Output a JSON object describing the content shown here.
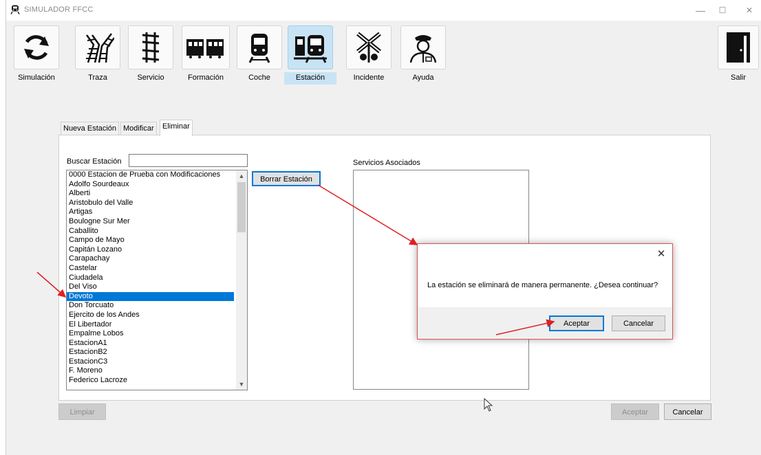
{
  "window": {
    "title": "SIMULADOR FFCC",
    "controls": {
      "minimize": "—",
      "maximize": "☐",
      "close": "✕"
    }
  },
  "toolbar": {
    "items": [
      {
        "label": "Simulación",
        "icon": "refresh-icon"
      },
      {
        "label": "Traza",
        "icon": "tracks-junction-icon"
      },
      {
        "label": "Servicio",
        "icon": "rail-track-icon"
      },
      {
        "label": "Formación",
        "icon": "train-formation-icon"
      },
      {
        "label": "Coche",
        "icon": "train-car-icon"
      },
      {
        "label": "Estación",
        "icon": "station-icon",
        "active": true
      },
      {
        "label": "Incidente",
        "icon": "railroad-crossing-icon"
      },
      {
        "label": "Ayuda",
        "icon": "conductor-icon"
      }
    ],
    "exit_label": "Salir"
  },
  "tabs": [
    "Nueva Estación",
    "Modificar",
    "Eliminar"
  ],
  "selected_tab": "Eliminar",
  "search": {
    "label": "Buscar Estación",
    "value": ""
  },
  "stations": [
    "0000 Estacion de Prueba con Modificaciones",
    "Adolfo Sourdeaux",
    "Alberti",
    "Aristobulo del Valle",
    "Artigas",
    "Boulogne Sur Mer",
    "Caballito",
    "Campo de Mayo",
    "Capitán Lozano",
    "Carapachay",
    "Castelar",
    "Ciudadela",
    "Del Viso",
    "Devoto",
    "Don Torcuato",
    "Ejercito de los Andes",
    "El Libertador",
    "Empalme Lobos",
    "EstacionA1",
    "EstacionB2",
    "EstacionC3",
    "F. Moreno",
    "Federico Lacroze"
  ],
  "selected_station": "Devoto",
  "delete_button": "Borrar Estación",
  "services_label": "Servicios Asociados",
  "bottom": {
    "clear": "Limpiar",
    "accept": "Aceptar",
    "cancel": "Cancelar"
  },
  "dialog": {
    "message": "La estación se eliminará de manera permanente. ¿Desea continuar?",
    "accept": "Aceptar",
    "cancel": "Cancelar",
    "close": "✕"
  },
  "colors": {
    "accent": "#0078d7",
    "active_tile": "#c8e4f4",
    "annotation_arrow": "#e02020"
  }
}
